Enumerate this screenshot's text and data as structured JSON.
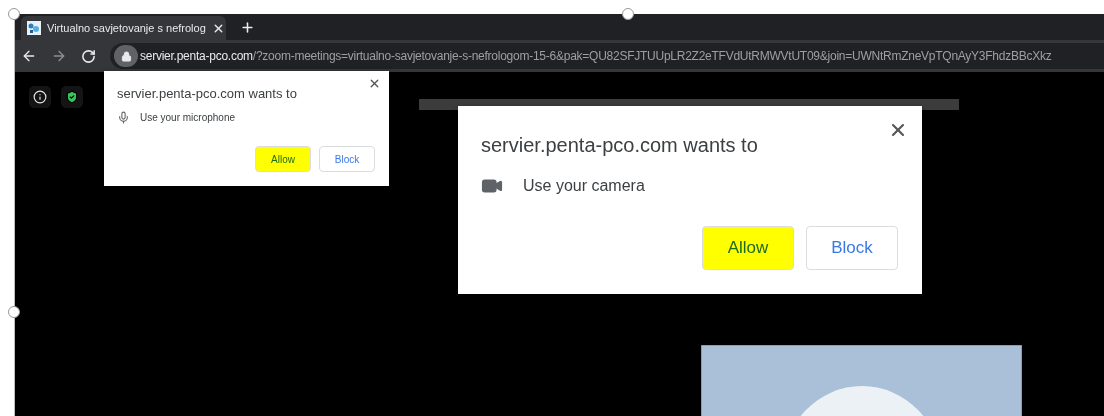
{
  "tab": {
    "title": "Virtualno savjetovanje s nefrolog"
  },
  "address_bar": {
    "host": "servier.penta-pco.com",
    "path": "/?zoom-meetings=virtualno-savjetovanje-s-nefrologom-15-6&pak=QU82SFJTUUpLR2Z2eTFVdUtRMWVtUT09&join=UWNtRmZneVpTQnAyY3FhdzBBcXkz"
  },
  "prompts": [
    {
      "kind": "microphone",
      "large": false,
      "title": "servier.penta-pco.com wants to",
      "permission": "Use your microphone",
      "buttons": [
        {
          "label": "Allow",
          "highlighted": true
        },
        {
          "label": "Block",
          "highlighted": false
        }
      ]
    },
    {
      "kind": "camera",
      "large": true,
      "title": "servier.penta-pco.com wants to",
      "permission": "Use your camera",
      "buttons": [
        {
          "label": "Allow",
          "highlighted": true
        },
        {
          "label": "Block",
          "highlighted": false
        }
      ]
    }
  ]
}
